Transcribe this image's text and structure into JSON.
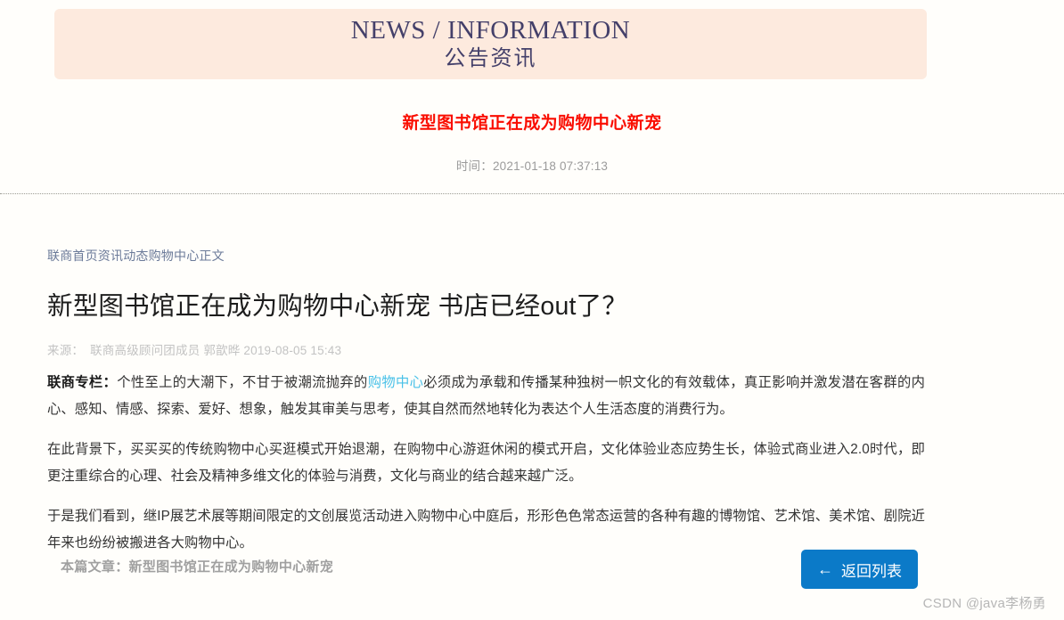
{
  "banner": {
    "english_title": "NEWS / INFORMATION",
    "chinese_title": "公告资讯",
    "background_color": "#fdeade",
    "text_color": "#44406a"
  },
  "post_header": {
    "title": "新型图书馆正在成为购物中心新宠",
    "title_color": "#fa0d00",
    "time_label": "时间：",
    "time_value": "2021-01-18 07:37:13"
  },
  "content": {
    "breadcrumb": "联商首页资讯动态购物中心正文",
    "heading": "新型图书馆正在成为购物中心新宠 书店已经out了？",
    "meta": {
      "source_label": "来源：",
      "source_value": "联商高级顾问团成员 郭歆晔",
      "date": "2019-08-05 15:43"
    },
    "paragraphs": [
      {
        "lead": "联商专栏：",
        "before_link": "个性至上的大潮下，不甘于被潮流抛弃的",
        "link": "购物中心",
        "after_link": "必须成为承载和传播某种独树一帜文化的有效载体，真正影响并激发潜在客群的内心、感知、情感、探索、爱好、想象，触发其审美与思考，使其自然而然地转化为表达个人生活态度的消费行为。"
      },
      {
        "text": "在此背景下，买买买的传统购物中心买逛模式开始退潮，在购物中心游逛休闲的模式开启，文化体验业态应势生长，体验式商业进入2.0时代，即更注重综合的心理、社会及精神多维文化的体验与消费，文化与商业的结合越来越广泛。"
      },
      {
        "text": "于是我们看到，继IP展艺术展等期间限定的文创展览活动进入购物中心中庭后，形形色色常态运营的各种有趣的博物馆、艺术馆、美术馆、剧院近年来也纷纷被搬进各大购物中心。"
      }
    ],
    "link_color": "#49c1e8"
  },
  "footer": {
    "this_article_label": "本篇文章：",
    "this_article_title": "新型图书馆正在成为购物中心新宠",
    "back_button": {
      "icon": "arrow-left-icon",
      "glyph": "←",
      "label": "返回列表",
      "background_color": "#0b7ac8"
    }
  },
  "watermark": "CSDN @java李杨勇"
}
